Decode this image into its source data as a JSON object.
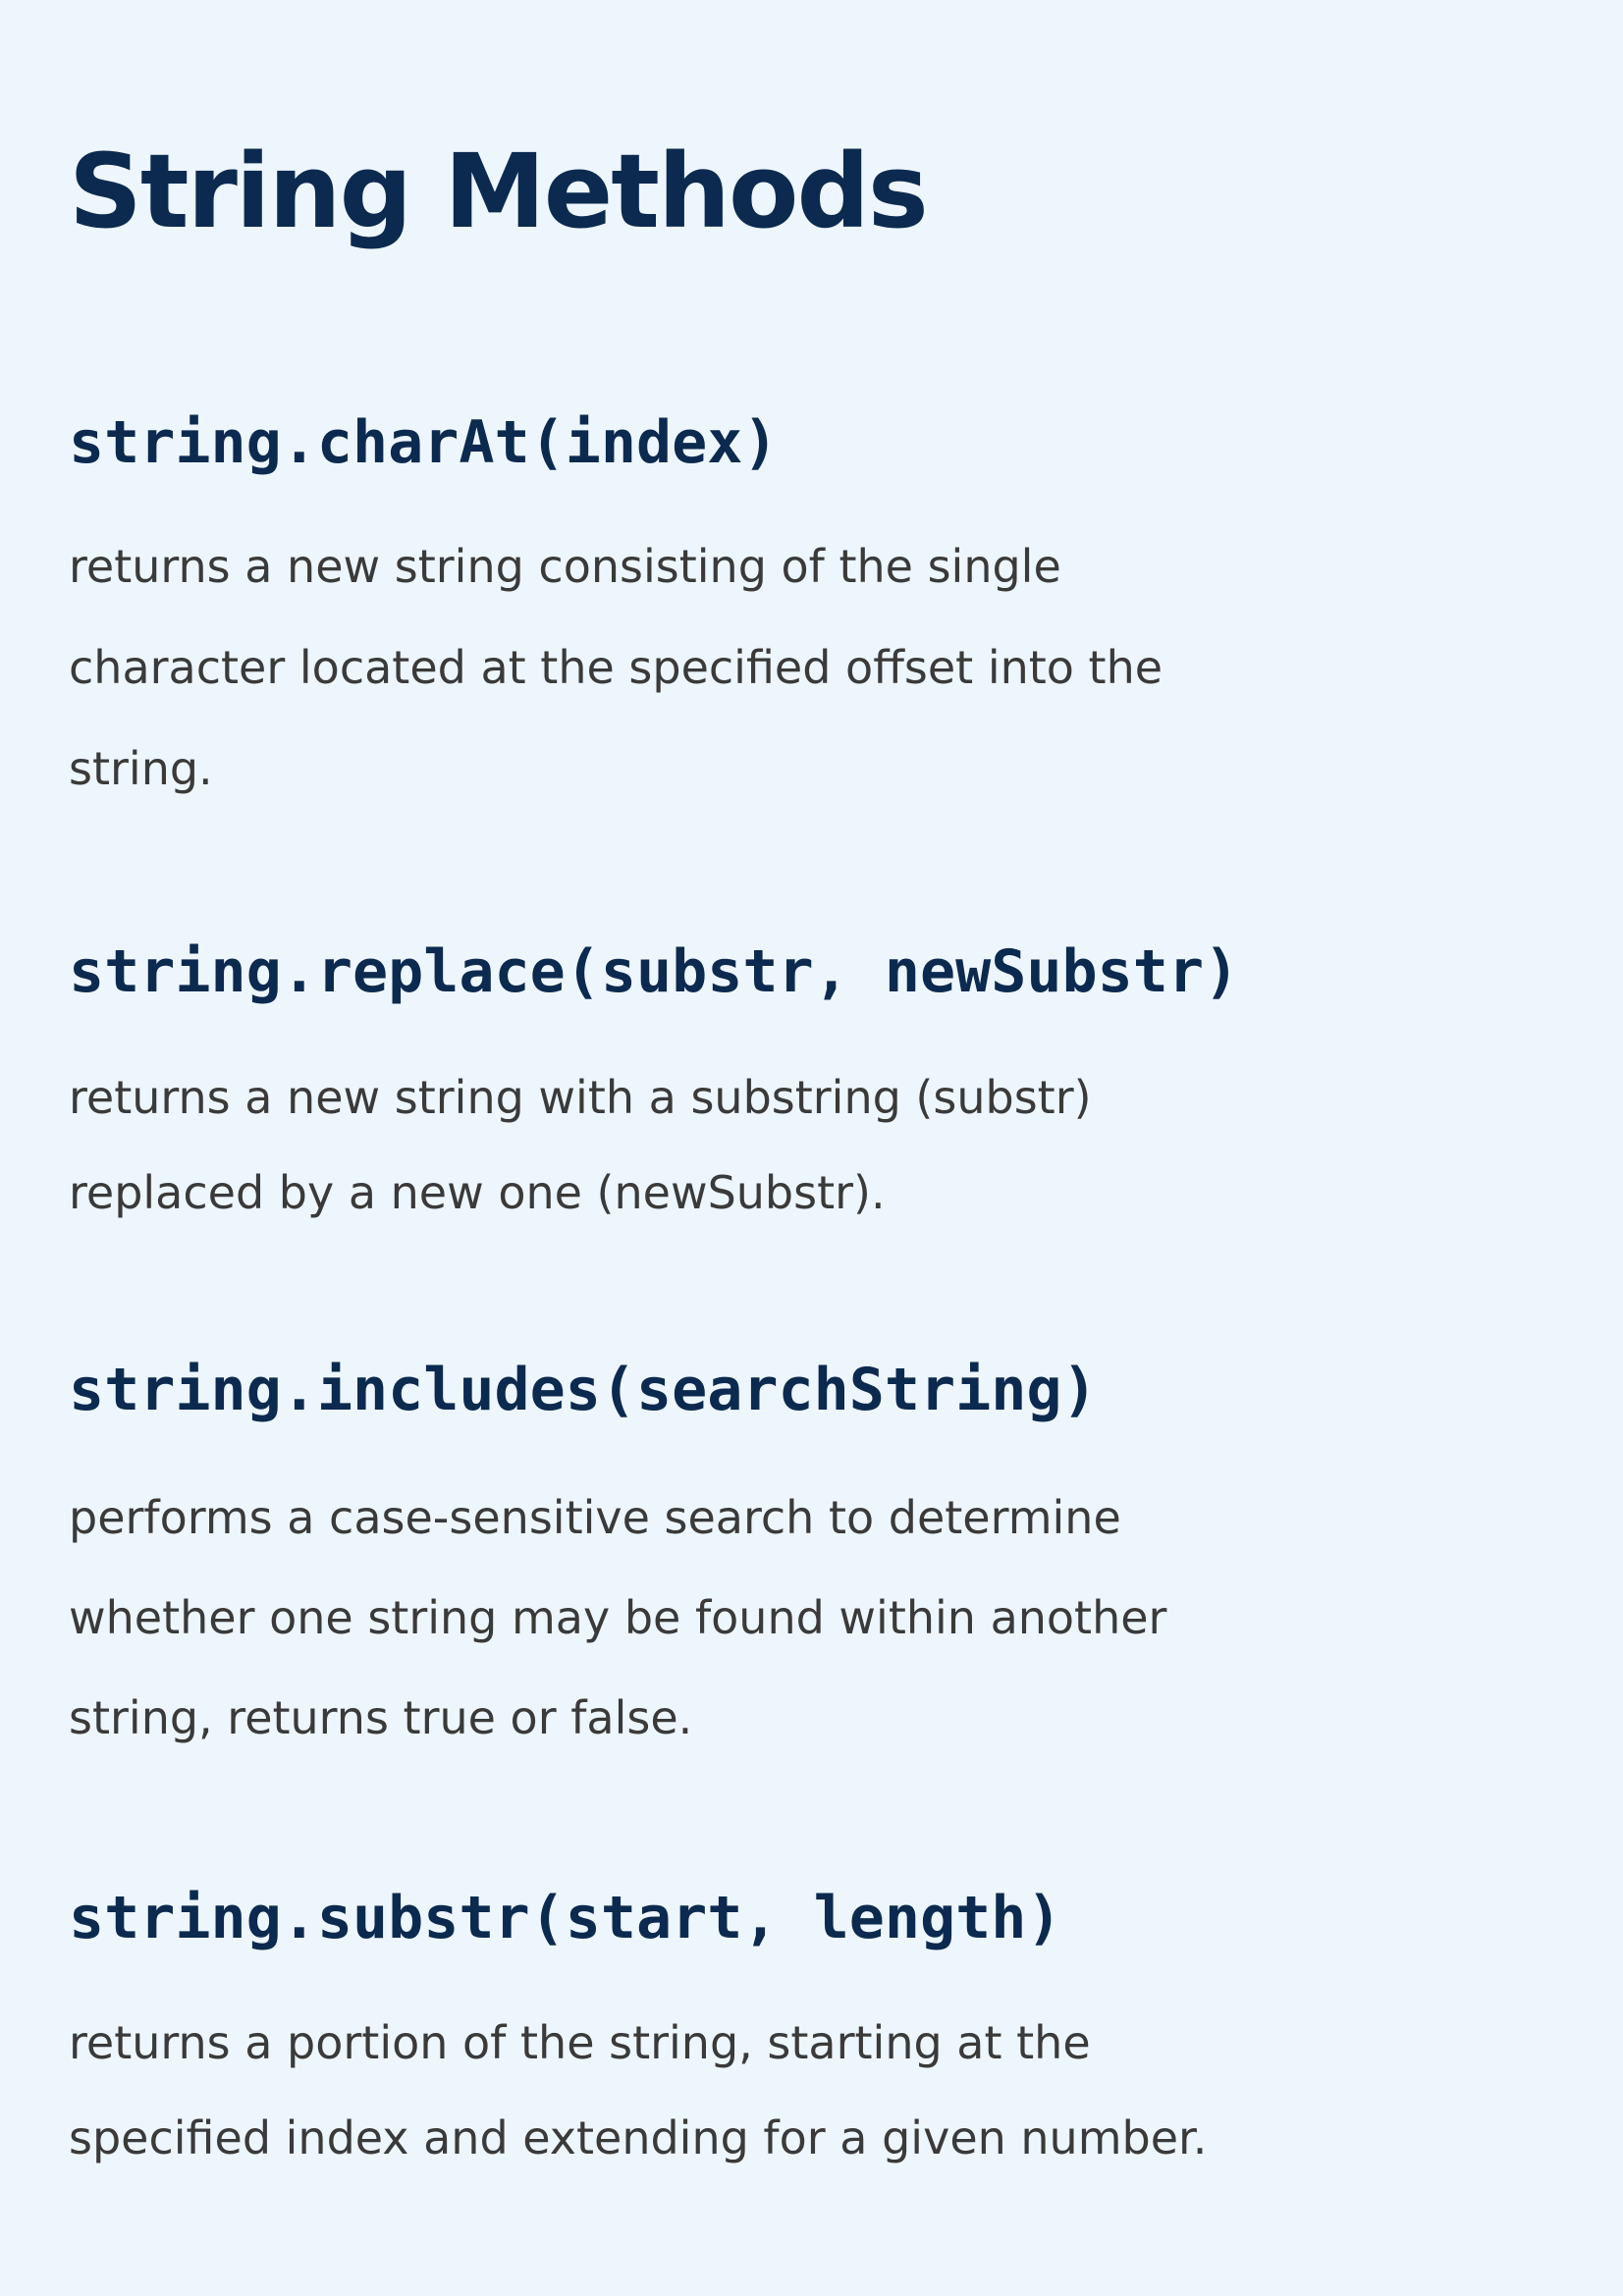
{
  "page": {
    "title": "String Methods",
    "background_color": "#eef6fd",
    "title_color": "#0c2a4f",
    "text_color": "#3a3a3a"
  },
  "methods": [
    {
      "signature": "string.charAt(index)",
      "description": "returns a new string consisting of the single\ncharacter located at the specified offset into the\nstring."
    },
    {
      "signature": "string.replace(substr, newSubstr)",
      "description": "returns a new string with a substring (substr)\nreplaced by a new one (newSubstr)."
    },
    {
      "signature": "string.includes(searchString)",
      "description": "performs a case-sensitive search to determine\nwhether one string may be found within another\nstring, returns true or false."
    },
    {
      "signature": "string.substr(start, length)",
      "description": "returns a portion of the string, starting at the\nspecified index and extending for a given number."
    }
  ]
}
